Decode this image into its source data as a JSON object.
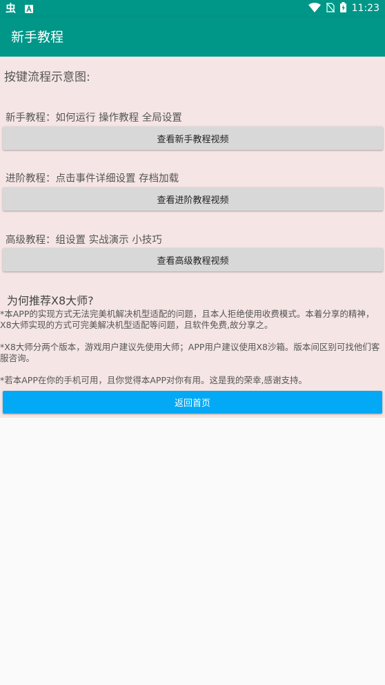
{
  "status_bar": {
    "time": "11:23",
    "left_icons": [
      "bug-icon",
      "notification-a-icon"
    ],
    "right_icons": [
      "wifi-icon",
      "no-sim-icon",
      "battery-icon"
    ]
  },
  "app_bar": {
    "title": "新手教程",
    "color": "#009688"
  },
  "content": {
    "heading": "按键流程示意图:",
    "sections": [
      {
        "label": "新手教程：如何运行 操作教程 全局设置",
        "button": "查看新手教程视频"
      },
      {
        "label": "进阶教程：点击事件详细设置 存档加载",
        "button": "查看进阶教程视频"
      },
      {
        "label": "高级教程：组设置 实战演示 小技巧",
        "button": "查看高级教程视频"
      }
    ],
    "why_heading": "为何推荐X8大师?",
    "paragraphs": [
      "*本APP的实现方式无法完美机解决机型适配的问题，且本人拒绝使用收费模式。本着分享的精神，X8大师实现的方式可完美解决机型适配等问题，且软件免费,故分享之。",
      "*X8大师分两个版本，游戏用户建议先使用大师；APP用户建议使用X8沙箱。版本间区别可找他们客服咨询。",
      "*若本APP在你的手机可用，且你觉得本APP对你有用。这是我的荣幸,感谢支持。"
    ],
    "home_button": "返回首页",
    "background_color": "#f5e5e5",
    "accent_color": "#03a9f4"
  }
}
